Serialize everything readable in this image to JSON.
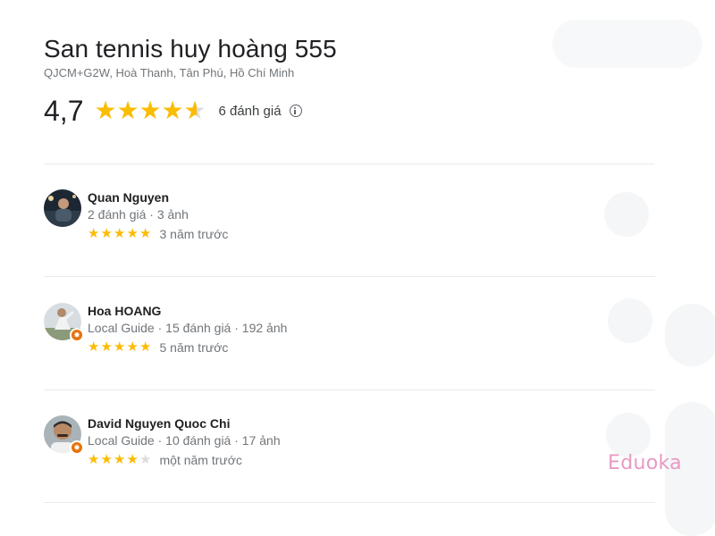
{
  "place": {
    "title": "San tennis huy hoàng 555",
    "address": "QJCM+G2W, Hoà Thanh, Tân Phú, Hồ Chí Minh",
    "rating": "4,7",
    "rating_value": 4.7,
    "review_count": "6 đánh giá",
    "star_color": "#fbbc04"
  },
  "reviews": [
    {
      "name": "Quan Nguyen",
      "meta": "2 đánh giá · 3 ảnh",
      "stars": 5,
      "time": "3 năm trước",
      "local_guide": false
    },
    {
      "name": "Hoa HOANG",
      "meta": "Local Guide · 15 đánh giá · 192 ảnh",
      "stars": 5,
      "time": "5 năm trước",
      "local_guide": true
    },
    {
      "name": "David Nguyen Quoc Chi",
      "meta": "Local Guide · 10 đánh giá · 17 ảnh",
      "stars": 4,
      "time": "một năm trước",
      "local_guide": true
    }
  ],
  "watermark": {
    "text": "Eduoka",
    "color": "#e89ac3"
  }
}
